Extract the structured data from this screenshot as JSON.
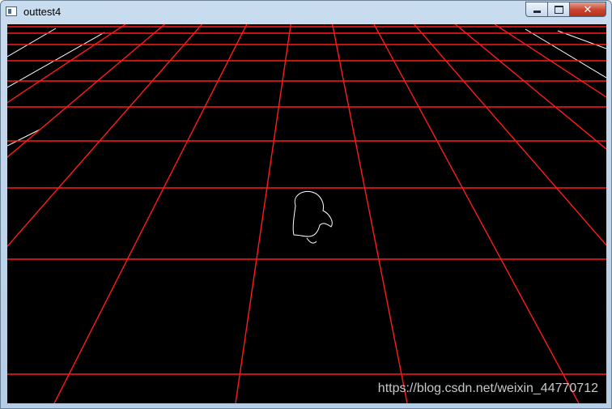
{
  "window": {
    "title": "outtest4",
    "icon": "app-window-icon",
    "controls": {
      "minimize_icon": "minimize-icon",
      "maximize_icon": "maximize-icon",
      "close_icon": "close-icon",
      "close_glyph": "✕"
    }
  },
  "image": {
    "description_icon": "perspective-grid-render",
    "background_color": "#000000",
    "grid_color": "#ff1a1a",
    "edge_color": "#ffffff"
  },
  "watermark": {
    "text": "https://blog.csdn.net/weixin_44770712"
  }
}
